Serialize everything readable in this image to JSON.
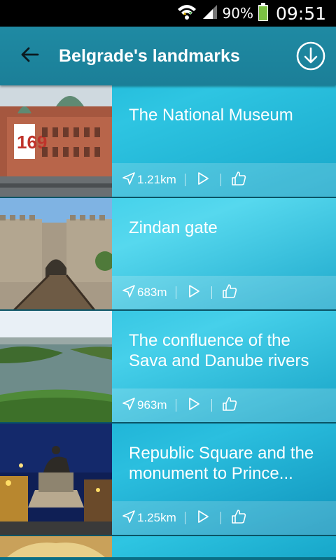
{
  "status_bar": {
    "battery": "90%",
    "time": "09:51"
  },
  "header": {
    "title": "Belgrade's landmarks"
  },
  "colors": {
    "appbar": "#1f8aa3",
    "list_accent": "#2ec5e2"
  },
  "landmarks": [
    {
      "title": "The National Museum",
      "distance": "1.21km"
    },
    {
      "title": "Zindan gate",
      "distance": "683m"
    },
    {
      "title": "The confluence of the Sava and Danube rivers",
      "distance": "963m"
    },
    {
      "title": "Republic Square and the monument to Prince...",
      "distance": "1.25km"
    }
  ],
  "icons": {
    "back": "arrow-left-icon",
    "download": "download-icon",
    "distance": "navigation-arrow-icon",
    "play": "play-icon",
    "like": "thumbs-up-icon"
  }
}
